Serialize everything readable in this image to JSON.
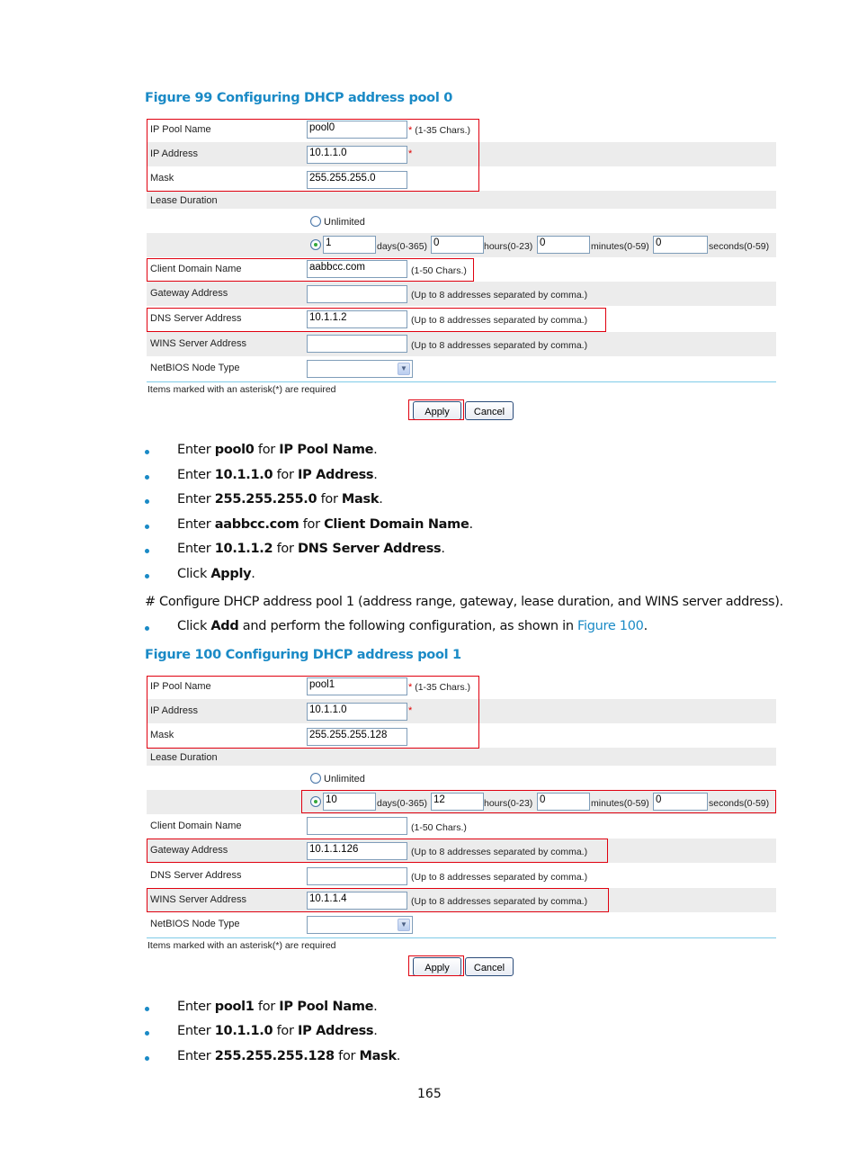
{
  "figure99": {
    "caption": "Figure 99 Configuring DHCP address pool 0",
    "ip_pool_name": {
      "label": "IP Pool Name",
      "value": "pool0",
      "required": "*",
      "hint": "(1-35 Chars.)"
    },
    "ip_address": {
      "label": "IP Address",
      "value": "10.1.1.0",
      "required": "*"
    },
    "mask": {
      "label": "Mask",
      "value": "255.255.255.0"
    },
    "lease_duration": {
      "label": "Lease Duration",
      "unlimited_label": "Unlimited",
      "selected": "custom",
      "days": "1",
      "days_unit": "days(0-365)",
      "hours": "0",
      "hours_unit": "hours(0-23)",
      "minutes": "0",
      "minutes_unit": "minutes(0-59)",
      "seconds": "0",
      "seconds_unit": "seconds(0-59)"
    },
    "client_domain_name": {
      "label": "Client Domain Name",
      "value": "aabbcc.com",
      "hint": "(1-50 Chars.)"
    },
    "gateway_address": {
      "label": "Gateway Address",
      "value": "",
      "hint": "(Up to 8 addresses separated by comma.)"
    },
    "dns_server_address": {
      "label": "DNS Server Address",
      "value": "10.1.1.2",
      "hint": "(Up to 8 addresses separated by comma.)"
    },
    "wins_server_address": {
      "label": "WINS Server Address",
      "value": "",
      "hint": "(Up to 8 addresses separated by comma.)"
    },
    "netbios_node_type": {
      "label": "NetBIOS Node Type",
      "value": ""
    },
    "required_note": "Items marked with an asterisk(*) are required",
    "apply_label": "Apply",
    "cancel_label": "Cancel"
  },
  "steps1": [
    {
      "pre": "Enter ",
      "b1": "pool0",
      "mid": " for ",
      "b2": "IP Pool Name",
      "post": "."
    },
    {
      "pre": "Enter ",
      "b1": "10.1.1.0",
      "mid": " for ",
      "b2": "IP Address",
      "post": "."
    },
    {
      "pre": "Enter ",
      "b1": "255.255.255.0",
      "mid": " for ",
      "b2": "Mask",
      "post": "."
    },
    {
      "pre": "Enter ",
      "b1": "aabbcc.com",
      "mid": " for ",
      "b2": "Client Domain Name",
      "post": "."
    },
    {
      "pre": "Enter ",
      "b1": "10.1.1.2",
      "mid": " for ",
      "b2": "DNS Server Address",
      "post": "."
    },
    {
      "pre": "Click ",
      "b1": "Apply",
      "mid": "",
      "b2": "",
      "post": "."
    }
  ],
  "configure_pool1_text": "# Configure DHCP address pool 1 (address range, gateway, lease duration, and WINS server address).",
  "click_add": {
    "pre": "Click ",
    "bold": "Add",
    "mid": " and perform the following configuration, as shown in ",
    "link": "Figure 100",
    "post": "."
  },
  "figure100": {
    "caption": "Figure 100 Configuring DHCP address pool 1",
    "ip_pool_name": {
      "label": "IP Pool Name",
      "value": "pool1",
      "required": "*",
      "hint": "(1-35 Chars.)"
    },
    "ip_address": {
      "label": "IP Address",
      "value": "10.1.1.0",
      "required": "*"
    },
    "mask": {
      "label": "Mask",
      "value": "255.255.255.128"
    },
    "lease_duration": {
      "label": "Lease Duration",
      "unlimited_label": "Unlimited",
      "selected": "custom",
      "days": "10",
      "days_unit": "days(0-365)",
      "hours": "12",
      "hours_unit": "hours(0-23)",
      "minutes": "0",
      "minutes_unit": "minutes(0-59)",
      "seconds": "0",
      "seconds_unit": "seconds(0-59)"
    },
    "client_domain_name": {
      "label": "Client Domain Name",
      "value": "",
      "hint": "(1-50 Chars.)"
    },
    "gateway_address": {
      "label": "Gateway Address",
      "value": "10.1.1.126",
      "hint": "(Up to 8 addresses separated by comma.)"
    },
    "dns_server_address": {
      "label": "DNS Server Address",
      "value": "",
      "hint": "(Up to 8 addresses separated by comma.)"
    },
    "wins_server_address": {
      "label": "WINS Server Address",
      "value": "10.1.1.4",
      "hint": "(Up to 8 addresses separated by comma.)"
    },
    "netbios_node_type": {
      "label": "NetBIOS Node Type",
      "value": ""
    },
    "required_note": "Items marked with an asterisk(*) are required",
    "apply_label": "Apply",
    "cancel_label": "Cancel"
  },
  "steps2": [
    {
      "pre": "Enter ",
      "b1": "pool1",
      "mid": " for ",
      "b2": "IP Pool Name",
      "post": "."
    },
    {
      "pre": "Enter ",
      "b1": "10.1.1.0",
      "mid": " for ",
      "b2": "IP Address",
      "post": "."
    },
    {
      "pre": "Enter ",
      "b1": "255.255.255.128",
      "mid": " for ",
      "b2": "Mask",
      "post": "."
    }
  ],
  "page_number": "165"
}
